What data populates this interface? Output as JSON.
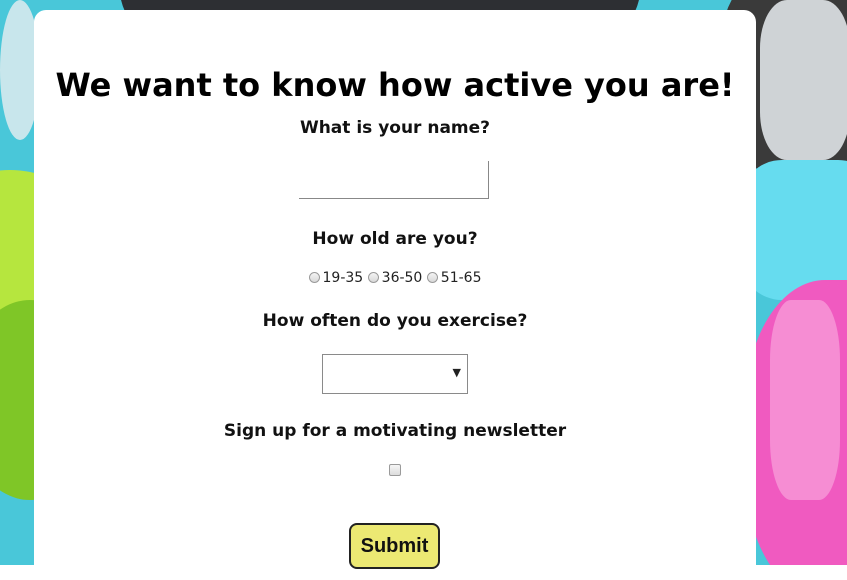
{
  "form": {
    "title": "We want to know how active you are!",
    "name_label": "What is your name?",
    "name_value": "",
    "age_label": "How old are you?",
    "age_options": [
      "19-35",
      "36-50",
      "51-65"
    ],
    "exercise_label": "How often do you exercise?",
    "exercise_selected": "",
    "newsletter_label": "Sign up for a motivating newsletter",
    "submit_label": "Submit"
  },
  "colors": {
    "card": "#ffffff",
    "submit_bg": "#ece973",
    "background_accent": "#49c7d9"
  },
  "icons": {
    "select_arrow": "chevron-down-icon"
  }
}
